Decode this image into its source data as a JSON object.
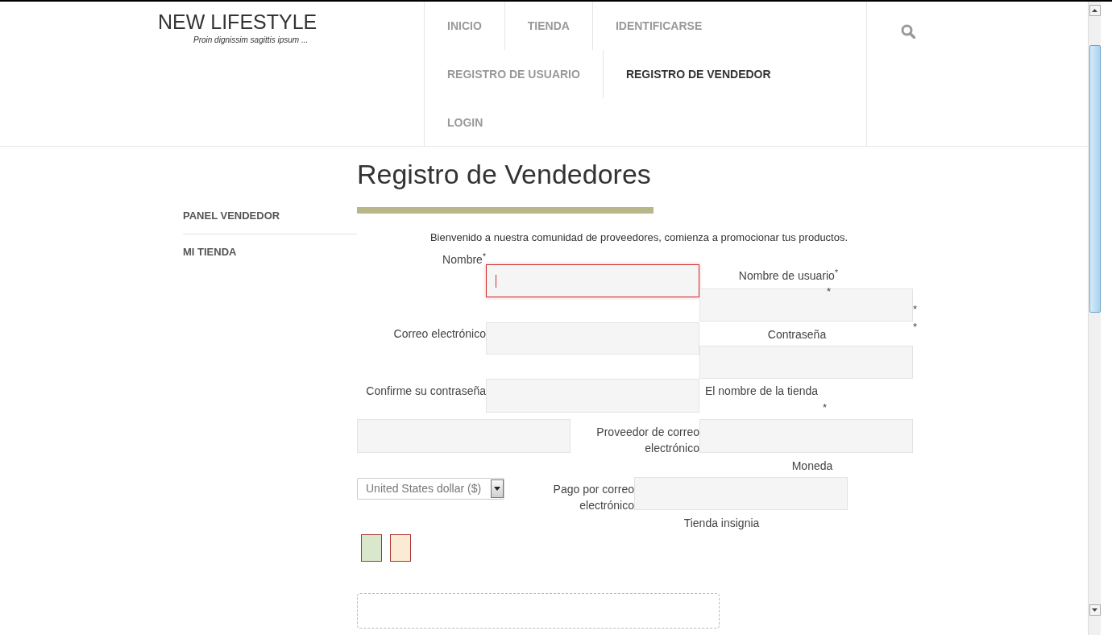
{
  "site": {
    "title": "NEW LIFESTYLE",
    "tagline": "Proin dignissim sagittis ipsum ..."
  },
  "nav": [
    {
      "label": "INICIO",
      "selected": false
    },
    {
      "label": "TIENDA",
      "selected": false
    },
    {
      "label": "IDENTIFICARSE",
      "selected": false
    },
    {
      "label": "REGISTRO DE USUARIO",
      "selected": false
    },
    {
      "label": "REGISTRO DE VENDEDOR",
      "selected": true
    },
    {
      "label": "LOGIN",
      "selected": false
    }
  ],
  "sidebar": {
    "items": [
      {
        "label": "PANEL VENDEDOR"
      },
      {
        "label": "MI TIENDA"
      }
    ]
  },
  "page": {
    "title": "Registro de Vendedores",
    "intro": "Bienvenido a nuestra comunidad de proveedores, comienza  a promocionar tus productos."
  },
  "form": {
    "items": [
      {
        "kind": "label",
        "text": "Nombre",
        "marker": "*"
      },
      {
        "kind": "input",
        "focused": true
      },
      {
        "kind": "label",
        "text": "Nombre de usuario",
        "marker": "*"
      },
      {
        "kind": "star",
        "text": "*"
      },
      {
        "kind": "input",
        "focused": false
      },
      {
        "kind": "star",
        "text": "*"
      },
      {
        "kind": "star",
        "text": "*"
      },
      {
        "kind": "label",
        "text": "Correo electrónico"
      },
      {
        "kind": "input",
        "focused": false
      },
      {
        "kind": "label",
        "text": "Contraseña"
      },
      {
        "kind": "input",
        "focused": false
      },
      {
        "kind": "label",
        "text": "Confirme su contraseña"
      },
      {
        "kind": "input",
        "focused": false
      },
      {
        "kind": "label",
        "text": "El nombre de la tienda"
      },
      {
        "kind": "star",
        "text": "*"
      },
      {
        "kind": "input",
        "focused": false
      },
      {
        "kind": "label",
        "text": "Proveedor de correo electrónico"
      },
      {
        "kind": "input",
        "focused": false
      },
      {
        "kind": "label",
        "text": "Moneda"
      },
      {
        "kind": "select",
        "value": "United States dollar ($)"
      },
      {
        "kind": "label",
        "text": "Pago por correo electrónico"
      },
      {
        "kind": "input",
        "focused": false
      },
      {
        "kind": "label",
        "text": "Tienda insignia"
      },
      {
        "kind": "swatch",
        "color": "#d9e8cc"
      },
      {
        "kind": "swatch",
        "color": "#fbebd2"
      },
      {
        "kind": "dropzone"
      }
    ]
  }
}
